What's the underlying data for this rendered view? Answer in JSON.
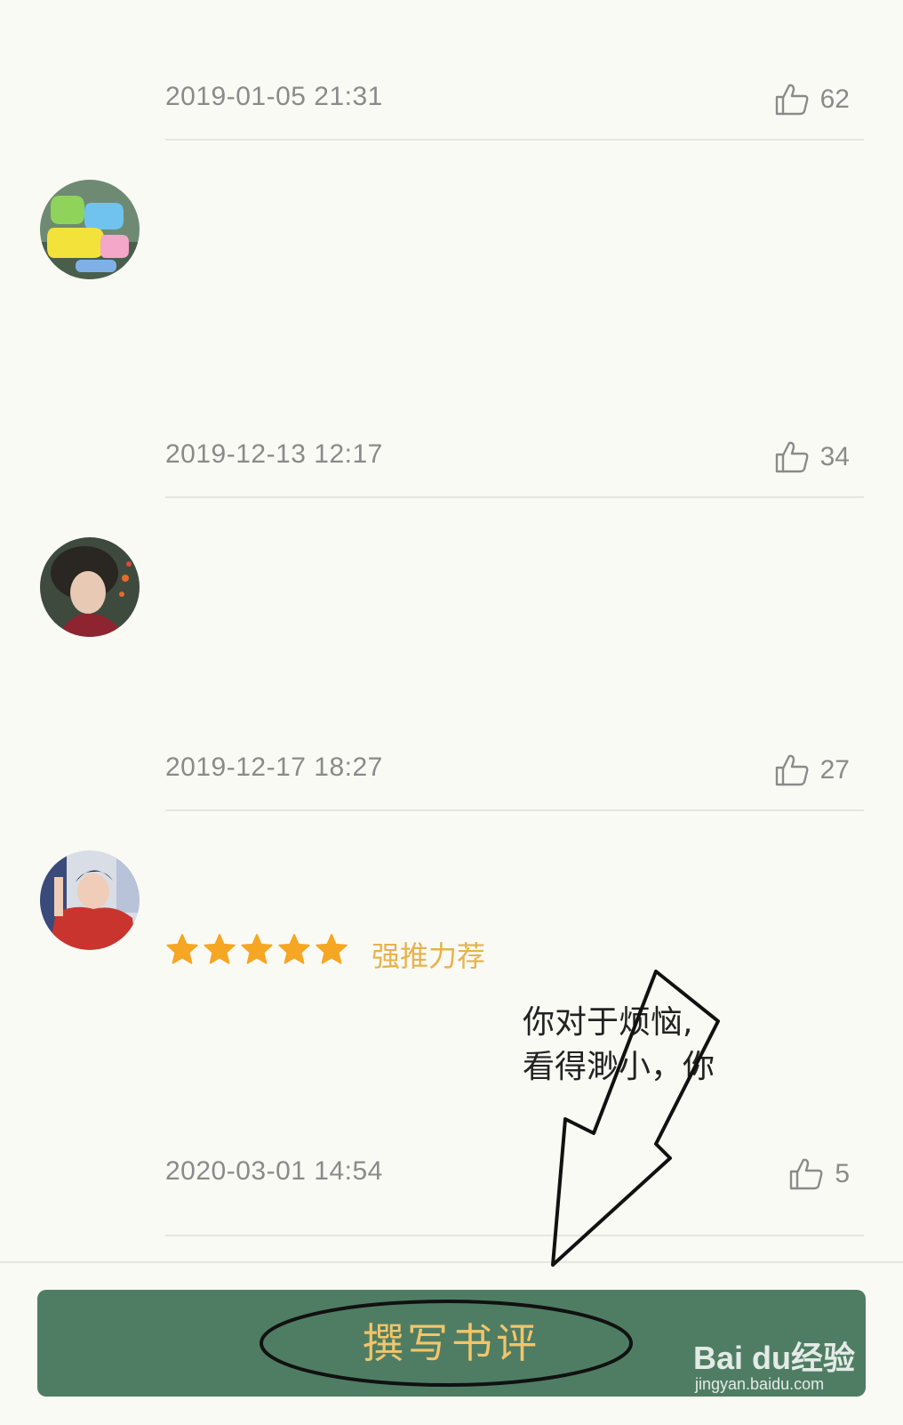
{
  "reviews": [
    {
      "date": "2019-01-05 21:31",
      "likes": "62"
    },
    {
      "date": "2019-12-13 12:17",
      "likes": "34"
    },
    {
      "date": "2019-12-17 18:27",
      "likes": "27"
    },
    {
      "date": "2020-03-01 14:54",
      "likes": "5",
      "rating_stars": 5,
      "rating_label": "强推力荐",
      "snippet_line1": "你对于烦恼,",
      "snippet_line2": "看得渺小，你"
    }
  ],
  "bottom_bar": {
    "write_review_label": "撰写书评"
  },
  "watermark": {
    "main": "Bai du经验",
    "sub": "jingyan.baidu.com"
  },
  "colors": {
    "background": "#fafaf5",
    "button": "#4f7d63",
    "button_text": "#f2c56a",
    "star": "#f5a623",
    "rating_text": "#e8b24a",
    "muted_text": "#8a8a8a"
  },
  "icons": {
    "like": "thumbs-up-icon",
    "star": "star-icon"
  }
}
